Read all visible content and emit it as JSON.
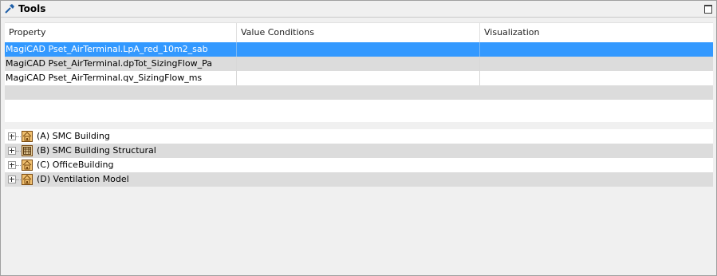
{
  "window": {
    "title": "Tools",
    "title_icon": "hammer-icon",
    "maximize_icon": "maximize-icon"
  },
  "grid": {
    "columns": [
      "Property",
      "Value Conditions",
      "Visualization"
    ],
    "rows": [
      {
        "property": "MagiCAD Pset_AirTerminal.LpA_red_10m2_sab",
        "value_conditions": "",
        "visualization": "",
        "selected": true
      },
      {
        "property": "MagiCAD Pset_AirTerminal.dpTot_SizingFlow_Pa",
        "value_conditions": "",
        "visualization": "",
        "selected": false
      },
      {
        "property": "MagiCAD Pset_AirTerminal.qv_SizingFlow_ms",
        "value_conditions": "",
        "visualization": "",
        "selected": false
      }
    ],
    "selection_color": "#3399ff"
  },
  "tree": {
    "items": [
      {
        "label": "(A) SMC Building",
        "icon": "building-icon"
      },
      {
        "label": "(B) SMC Building Structural",
        "icon": "structural-building-icon"
      },
      {
        "label": "(C) OfficeBuilding",
        "icon": "building-icon"
      },
      {
        "label": "(D) Ventilation Model",
        "icon": "building-icon"
      }
    ]
  }
}
